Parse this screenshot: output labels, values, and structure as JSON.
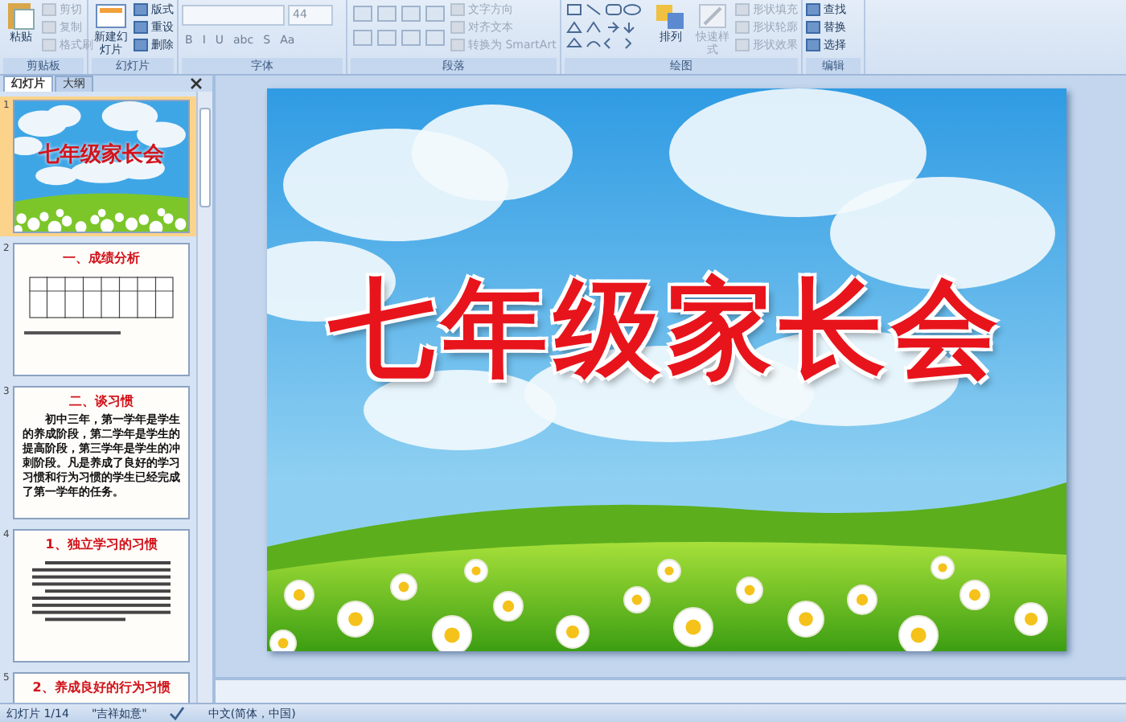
{
  "ribbon": {
    "groups": [
      {
        "kind": "clipboard",
        "label": "剪贴板",
        "large": "粘贴",
        "small": [
          {
            "label": "剪切",
            "disabled": true
          },
          {
            "label": "复制",
            "disabled": true
          },
          {
            "label": "格式刷",
            "disabled": true
          }
        ]
      },
      {
        "kind": "slides",
        "label": "幻灯片",
        "large": "新建幻灯片",
        "small": [
          {
            "label": "版式",
            "disabled": false
          },
          {
            "label": "重设",
            "disabled": false
          },
          {
            "label": "删除",
            "disabled": false
          }
        ]
      },
      {
        "kind": "font",
        "label": "字体",
        "font_size": "44",
        "buttons": [
          "B",
          "I",
          "U",
          "abc",
          "S",
          "Aa"
        ]
      },
      {
        "kind": "paragraph",
        "label": "段落",
        "small": [
          {
            "label": "文字方向",
            "disabled": true
          },
          {
            "label": "对齐文本",
            "disabled": true
          },
          {
            "label": "转换为 SmartArt",
            "disabled": true
          }
        ]
      },
      {
        "kind": "drawing",
        "label": "绘图",
        "large": "排列",
        "quick": "快速样式",
        "small": [
          {
            "label": "形状填充",
            "disabled": true
          },
          {
            "label": "形状轮廓",
            "disabled": true
          },
          {
            "label": "形状效果",
            "disabled": true
          }
        ]
      },
      {
        "kind": "editing",
        "label": "编辑",
        "small": [
          {
            "label": "查找",
            "disabled": false
          },
          {
            "label": "替换",
            "disabled": false
          },
          {
            "label": "选择",
            "disabled": false
          }
        ]
      }
    ]
  },
  "panel": {
    "tabs": [
      {
        "label": "幻灯片",
        "selected": true
      },
      {
        "label": "大纲",
        "selected": false
      }
    ],
    "slides": [
      {
        "number": "1",
        "kind": "cover",
        "selected": true,
        "title": "七年级家长会"
      },
      {
        "number": "2",
        "kind": "table",
        "selected": false,
        "title": "一、成绩分析"
      },
      {
        "number": "3",
        "kind": "text",
        "selected": false,
        "title": "二、谈习惯",
        "body": "初中三年，第一学年是学生的养成阶段，第二学年是学生的提高阶段，第三学年是学生的冲刺阶段。凡是养成了良好的学习习惯和行为习惯的学生已经完成了第一学年的任务。"
      },
      {
        "number": "4",
        "kind": "lines",
        "selected": false,
        "title": "1、独立学习的习惯"
      },
      {
        "number": "5",
        "kind": "lines",
        "selected": false,
        "title": "2、养成良好的行为习惯"
      }
    ]
  },
  "slide": {
    "title": "七年级家长会"
  },
  "status_bar": [
    "幻灯片 1/14",
    "\"吉祥如意\"",
    "中文(简体，中国)"
  ]
}
